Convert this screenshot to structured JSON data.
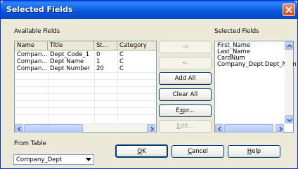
{
  "window": {
    "title": "Selected Fields"
  },
  "available": {
    "label": "Available Fields",
    "columns": [
      "Name",
      "Title",
      "St...",
      "Category"
    ],
    "rows": [
      [
        "Compan...",
        "Dept_Code_1",
        "0",
        "C"
      ],
      [
        "Compan...",
        "Dept Name",
        "1",
        "C"
      ],
      [
        "Compan...",
        "Dept Number",
        "20",
        "C"
      ]
    ]
  },
  "buttons": {
    "add": "->",
    "remove": "<-",
    "add_all": "Add All",
    "clear_all": "Clear All",
    "expr_pre": "E",
    "expr_u": "x",
    "expr_post": "pr...",
    "edit_u": "E",
    "edit_post": "dit...",
    "ok_u": "O",
    "ok_post": "K",
    "cancel_u": "C",
    "cancel_post": "ancel",
    "help_u": "H",
    "help_post": "elp"
  },
  "selected": {
    "label": "Selected Fields",
    "items": [
      "First_Name",
      "Last_Name",
      "CardNum",
      "Company_Dept.Dept_Nam"
    ]
  },
  "from_table": {
    "label": "From Table",
    "value": "Company_Dept"
  }
}
